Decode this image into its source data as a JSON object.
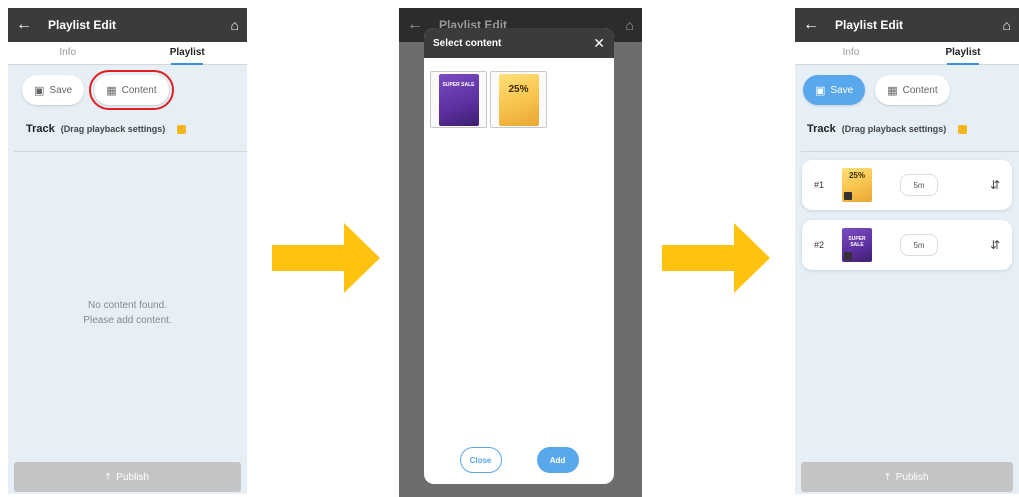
{
  "screen1": {
    "title": "Playlist Edit",
    "tabs": [
      "Info",
      "Playlist"
    ],
    "save_label": "Save",
    "content_label": "Content",
    "track_title": "Track",
    "track_hint": "(Drag playback settings)",
    "empty_line1": "No content found.",
    "empty_line2": "Please add content.",
    "publish_label": "Publish"
  },
  "screen2": {
    "title": "Playlist Edit",
    "modal_title": "Select content",
    "close_label": "Close",
    "add_label": "Add",
    "items": [
      {
        "name": "super-sale-purple",
        "text": "SUPER SALE"
      },
      {
        "name": "flash-sale-yellow",
        "text": "25%"
      }
    ]
  },
  "screen3": {
    "title": "Playlist Edit",
    "tabs": [
      "Info",
      "Playlist"
    ],
    "save_label": "Save",
    "content_label": "Content",
    "track_title": "Track",
    "track_hint": "(Drag playback settings)",
    "tracks": [
      {
        "num": "#1",
        "thumb_text": "25%",
        "duration": "5m"
      },
      {
        "num": "#2",
        "thumb_text": "SUPER SALE",
        "duration": "5m"
      }
    ],
    "publish_label": "Publish"
  },
  "colors": {
    "topbar": "#3b3b3b",
    "accent_blue": "#5aa8ec",
    "highlight_red": "#e02020",
    "arrow_yellow": "#ffc20e",
    "background": "#e6eff6"
  },
  "icons": {
    "back": "arrow-left-icon",
    "home": "home-icon",
    "save": "floppy-icon",
    "content": "add-content-icon",
    "publish": "upload-icon",
    "close": "close-icon",
    "sort": "sort-icon"
  }
}
